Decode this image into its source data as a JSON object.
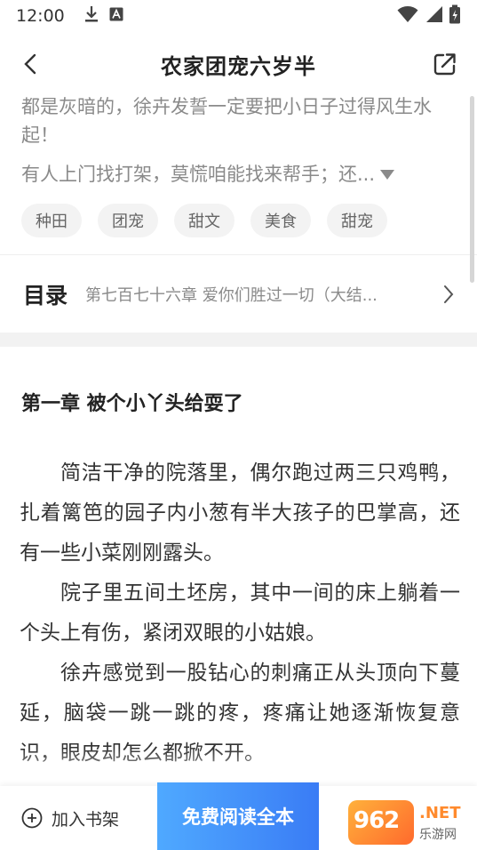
{
  "status_bar": {
    "time": "12:00",
    "icons": [
      "download-icon",
      "notification-a-icon",
      "wifi-icon",
      "signal-icon",
      "battery-icon"
    ]
  },
  "nav": {
    "title": "农家团宠六岁半",
    "back_icon": "chevron-left-icon",
    "share_icon": "share-icon"
  },
  "intro": {
    "line1": "都是灰暗的，徐卉发誓一定要把小日子过得风生水起！",
    "line2": "有人上门找打架，莫慌咱能找来帮手；还..."
  },
  "tags": [
    "种田",
    "团宠",
    "甜文",
    "美食",
    "甜宠"
  ],
  "toc": {
    "label": "目录",
    "latest_chapter": "第七百七十六章 爱你们胜过一切（大结..."
  },
  "chapter": {
    "title": "第一章 被个小丫头给耍了",
    "paragraphs": [
      "简洁干净的院落里，偶尔跑过两三只鸡鸭，扎着篱笆的园子内小葱有半大孩子的巴掌高，还有一些小菜刚刚露头。",
      "院子里五间土坯房，其中一间的床上躺着一个头上有伤，紧闭双眼的小姑娘。",
      "徐卉感觉到一股钻心的刺痛正从头顶向下蔓延，脑袋一跳一跳的疼，疼痛让她逐渐恢复意识，眼皮却怎么都掀不开。"
    ]
  },
  "bottom_bar": {
    "shelf_label": "加入书架",
    "read_label": "免费阅读全本"
  },
  "watermark": {
    "number": "962",
    "net": ".NET",
    "cn": "乐游网"
  },
  "colors": {
    "accent_blue": "#3a7cf5",
    "muted_text": "#8a8a8a",
    "tag_bg": "#f3f3f3"
  }
}
